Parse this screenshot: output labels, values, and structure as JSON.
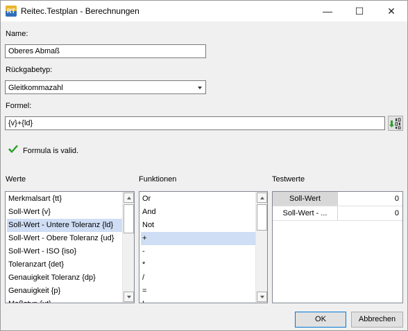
{
  "window": {
    "title": "Reitec.Testplan - Berechnungen",
    "app_icon_text": "RT"
  },
  "controls": {
    "minimize": "—",
    "maximize": "☐",
    "close": "✕"
  },
  "name": {
    "label": "Name:",
    "value": "Oberes Abmaß"
  },
  "return_type": {
    "label": "Rückgabetyp:",
    "value": "Gleitkommazahl"
  },
  "formula": {
    "label": "Formel:",
    "value": "{v}+{ld}",
    "button_icon": "formula-evaluate-icon"
  },
  "validation": {
    "icon": "checkmark-icon",
    "status_color": "#2e9e2e",
    "message": "Formula is valid."
  },
  "werte": {
    "label": "Werte",
    "items": [
      "Merkmalsart {tt}",
      "Soll-Wert {v}",
      "Soll-Wert - Untere Toleranz {ld}",
      "Soll-Wert - Obere Toleranz {ud}",
      "Soll-Wert - ISO {iso}",
      "Toleranzart {det}",
      "Genauigkeit Toleranz {dp}",
      "Genauigkeit {p}",
      "Maßstyp {ut}"
    ],
    "selected": "Soll-Wert - Untere Toleranz {ld}"
  },
  "funktionen": {
    "label": "Funktionen",
    "items": [
      "Or",
      "And",
      "Not",
      "+",
      "-",
      "*",
      "/",
      "=",
      "!"
    ],
    "selected": "+"
  },
  "testwerte": {
    "label": "Testwerte",
    "rows": [
      {
        "name": "Soll-Wert",
        "value": "0"
      },
      {
        "name": "Soll-Wert - ...",
        "value": "0"
      }
    ]
  },
  "buttons": {
    "ok": "OK",
    "cancel": "Abbrechen"
  }
}
